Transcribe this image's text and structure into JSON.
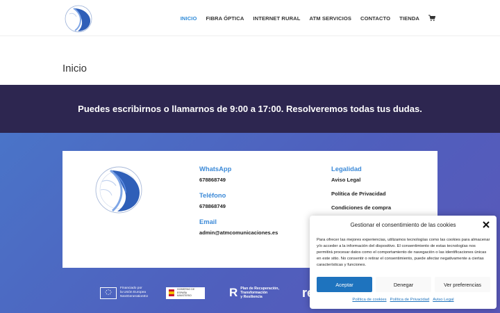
{
  "header": {
    "nav": [
      {
        "label": "INICIO",
        "active": true
      },
      {
        "label": "FIBRA ÓPTICA",
        "active": false
      },
      {
        "label": "INTERNET RURAL",
        "active": false
      },
      {
        "label": "ATM SERVICIOS",
        "active": false
      },
      {
        "label": "CONTACTO",
        "active": false
      },
      {
        "label": "TIENDA",
        "active": false
      }
    ],
    "cart_icon": "shopping-cart-icon"
  },
  "page": {
    "title": "Inicio"
  },
  "banner": {
    "text": "Puedes escribirnos o llamarnos de 9:00 a 17:00. Resolveremos todas tus dudas."
  },
  "footer": {
    "contact": {
      "whatsapp_label": "WhatsApp",
      "whatsapp_value": "678868749",
      "phone_label": "Teléfono",
      "phone_value": "678868749",
      "email_label": "Email",
      "email_value": "admin@atmcomunicaciones.es"
    },
    "legal": {
      "heading": "Legalidad",
      "links": [
        "Aviso Legal",
        "Política de Privacidad",
        "Condiciones de compra"
      ]
    },
    "funding": {
      "eu_line1": "Financiado por",
      "eu_line2": "la Unión Europea",
      "eu_line3": "NextGenerationEU",
      "gov_line1": "GOBIERNO DE ESPAÑA",
      "gov_line2": "MINISTERIO",
      "prtr_mark": "R",
      "prtr_line1": "Plan de Recuperación,",
      "prtr_line2": "Transformación",
      "prtr_line3": "y Resiliencia",
      "partial_logo": "re"
    }
  },
  "cookie": {
    "title": "Gestionar el consentimiento de las cookies",
    "body": "Para ofrecer las mejores experiencias, utilizamos tecnologías como las cookies para almacenar y/o acceder a la información del dispositivo. El consentimiento de estas tecnologías nos permitirá procesar datos como el comportamiento de navegación o las identificaciones únicas en este sitio. No consentir o retirar el consentimiento, puede afectar negativamente a ciertas características y funciones.",
    "accept": "Aceptar",
    "deny": "Denegar",
    "preferences": "Ver preferencias",
    "links": [
      "Política de cookies",
      "Política de Privacidad",
      "Aviso Legal"
    ]
  },
  "colors": {
    "accent": "#2e8ad8",
    "banner_bg": "#2d2650",
    "button_blue": "#1e73be"
  }
}
